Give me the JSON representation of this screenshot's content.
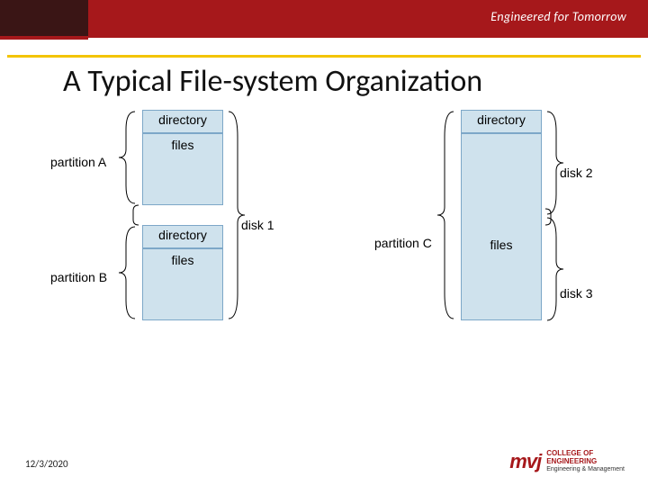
{
  "header": {
    "tagline": "Engineered for Tomorrow"
  },
  "title": "A Typical File-system Organization",
  "diagram": {
    "blocks": {
      "dirA": "directory",
      "filesA": "files",
      "dirB": "directory",
      "filesB": "files",
      "dirR": "directory",
      "filesR": "files"
    },
    "labels": {
      "partitionA": "partition A",
      "partitionB": "partition B",
      "partitionC": "partition C",
      "disk1": "disk 1",
      "disk2": "disk 2",
      "disk3": "disk 3"
    }
  },
  "footer": {
    "date": "12/3/2020",
    "logo_mark": "mvj",
    "logo_line1": "COLLEGE OF",
    "logo_line2": "ENGINEERING",
    "logo_line3": "Engineering & Management"
  }
}
